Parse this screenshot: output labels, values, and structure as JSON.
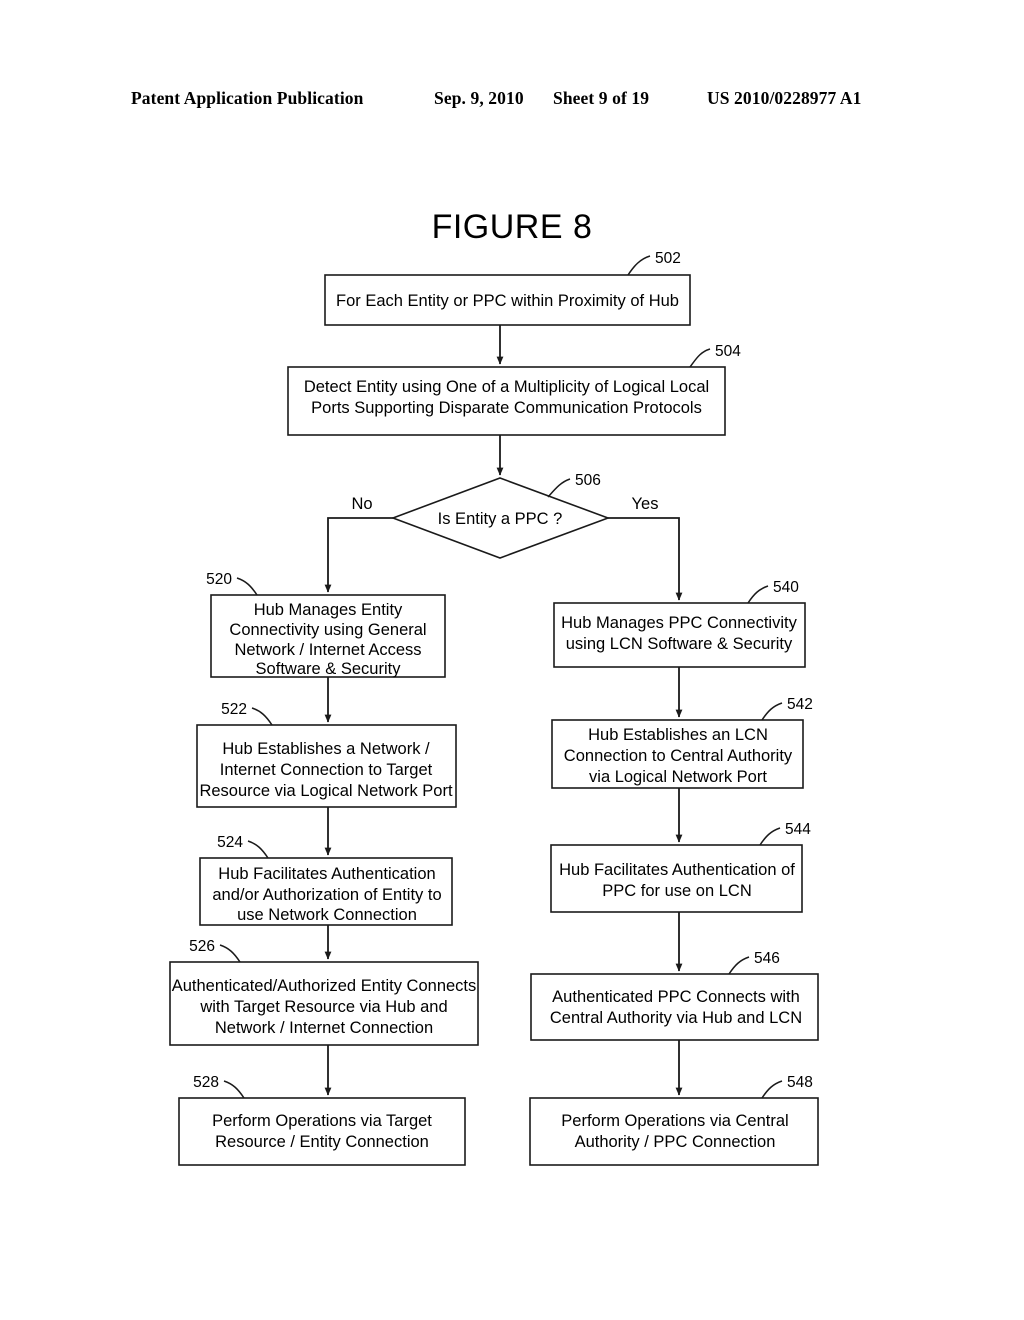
{
  "header": {
    "publication": "Patent Application Publication",
    "date": "Sep. 9, 2010",
    "sheet": "Sheet 9 of 19",
    "patent_number": "US 2010/0228977 A1"
  },
  "figure": {
    "title": "FIGURE 8"
  },
  "flowchart": {
    "branch_labels": {
      "no": "No",
      "yes": "Yes"
    },
    "nodes": [
      {
        "id": "502",
        "ref": "502",
        "shape": "process",
        "lines": [
          "For Each Entity or PPC within Proximity of Hub"
        ]
      },
      {
        "id": "504",
        "ref": "504",
        "shape": "process",
        "lines": [
          "Detect Entity using One of a Multiplicity of Logical Local",
          "Ports Supporting Disparate Communication Protocols"
        ]
      },
      {
        "id": "506",
        "ref": "506",
        "shape": "decision",
        "lines": [
          "Is Entity a PPC ?"
        ]
      },
      {
        "id": "520",
        "ref": "520",
        "shape": "process",
        "lines": [
          "Hub Manages Entity",
          "Connectivity using General",
          "Network / Internet Access",
          "Software & Security"
        ]
      },
      {
        "id": "522",
        "ref": "522",
        "shape": "process",
        "lines": [
          "Hub Establishes a Network /",
          "Internet Connection to Target",
          "Resource via Logical Network Port"
        ]
      },
      {
        "id": "524",
        "ref": "524",
        "shape": "process",
        "lines": [
          "Hub Facilitates Authentication",
          "and/or Authorization of Entity to",
          "use Network Connection"
        ]
      },
      {
        "id": "526",
        "ref": "526",
        "shape": "process",
        "lines": [
          "Authenticated/Authorized Entity Connects",
          "with Target Resource via Hub and",
          "Network / Internet Connection"
        ]
      },
      {
        "id": "528",
        "ref": "528",
        "shape": "process",
        "lines": [
          "Perform Operations via Target",
          "Resource / Entity Connection"
        ]
      },
      {
        "id": "540",
        "ref": "540",
        "shape": "process",
        "lines": [
          "Hub Manages PPC Connectivity",
          "using LCN Software & Security"
        ]
      },
      {
        "id": "542",
        "ref": "542",
        "shape": "process",
        "lines": [
          "Hub Establishes an LCN",
          "Connection to Central Authority",
          "via Logical Network Port"
        ]
      },
      {
        "id": "544",
        "ref": "544",
        "shape": "process",
        "lines": [
          "Hub Facilitates Authentication of",
          "PPC for use on LCN"
        ]
      },
      {
        "id": "546",
        "ref": "546",
        "shape": "process",
        "lines": [
          "Authenticated PPC Connects with",
          "Central Authority via Hub and LCN"
        ]
      },
      {
        "id": "548",
        "ref": "548",
        "shape": "process",
        "lines": [
          "Perform Operations via Central",
          "Authority / PPC Connection"
        ]
      }
    ]
  }
}
